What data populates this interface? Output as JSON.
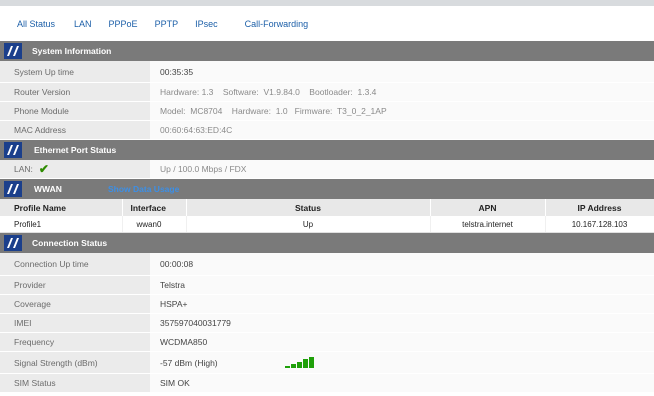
{
  "tabs": [
    "All Status",
    "LAN",
    "PPPoE",
    "PPTP",
    "IPsec",
    "Call-Forwarding"
  ],
  "system": {
    "title": "System Information",
    "rows": [
      {
        "label": "System Up time",
        "value": "00:35:35"
      },
      {
        "label": "Router Version",
        "value": "Hardware: 1.3    Software:  V1.9.84.0    Bootloader:  1.3.4"
      },
      {
        "label": "Phone Module",
        "value": "Model:  MC8704    Hardware:  1.0   Firmware:  T3_0_2_1AP"
      },
      {
        "label": "MAC Address",
        "value": "00:60:64:63:ED:4C"
      }
    ]
  },
  "ethernet": {
    "title": "Ethernet Port Status",
    "lan_label": "LAN:",
    "lan_status_icon": "check-icon",
    "lan_value": "Up / 100.0 Mbps / FDX"
  },
  "wwan": {
    "title": "WWAN",
    "link": "Show Data Usage",
    "columns": [
      "Profile Name",
      "Interface",
      "Status",
      "APN",
      "IP Address"
    ],
    "rows": [
      [
        "Profile1",
        "wwan0",
        "Up",
        "telstra.internet",
        "10.167.128.103"
      ]
    ]
  },
  "connection": {
    "title": "Connection Status",
    "rows": [
      {
        "label": "Connection Up time",
        "value": "00:00:08"
      },
      {
        "label": "Provider",
        "value": "Telstra"
      },
      {
        "label": "Coverage",
        "value": "HSPA+"
      },
      {
        "label": "IMEI",
        "value": "357597040031779"
      },
      {
        "label": "Frequency",
        "value": "WCDMA850"
      },
      {
        "label": "Signal Strength (dBm)",
        "value": "-57 dBm (High)"
      },
      {
        "label": "SIM Status",
        "value": "SIM OK"
      }
    ],
    "signal_bars_filled": 5,
    "signal_bars_total": 5
  },
  "colors": {
    "header_bg": "#7a7a7a",
    "logo_bg": "#1b3f8b",
    "link": "#1c5fa8",
    "ok_green": "#3cb21c",
    "signal_green": "#1fa00a"
  }
}
